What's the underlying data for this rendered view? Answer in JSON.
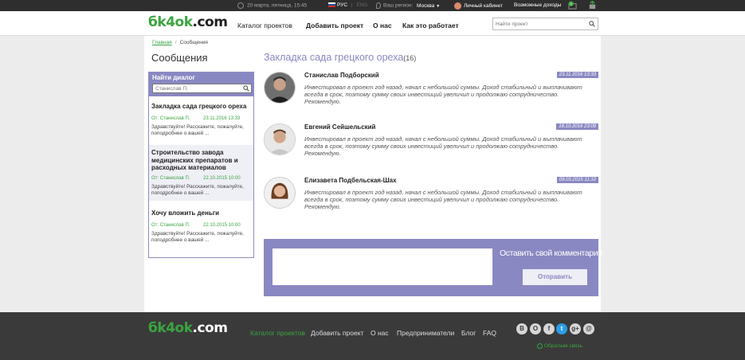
{
  "topbar": {
    "datetime": "20 марта, пятница, 15:45",
    "lang_ru": "РУС",
    "lang_divider": "|",
    "lang_en": "ENG",
    "region_label": "Ваш регион:",
    "region_value": "Москва",
    "cabinet": "Личный кабинет",
    "income": "Возможные доходы",
    "notif_count": "0"
  },
  "header": {
    "logo_a": "бk",
    "logo_b": "4ok",
    "logo_c": ".com",
    "nav": [
      "Каталог проектов",
      "Добавить проект",
      "О нас",
      "Как это работает"
    ],
    "search_placeholder": "Найти проект"
  },
  "breadcrumb": {
    "home": "Главная",
    "sep": "/",
    "current": "Сообщения"
  },
  "sidebar": {
    "title": "Сообщения",
    "find_label": "Найти диалог",
    "search_placeholder": "Станислав П.",
    "dialogs": [
      {
        "title": "Закладка сада грецкого ореха",
        "from": "От: Станислав П.",
        "date": "23.11.2016 13:33",
        "snippet": "Здравствуйте! Расскажите, пожалуйте, поподробнее о вашей ..."
      },
      {
        "title": "Строительство завода медицинских препаратов и расходных материалов",
        "from": "От: Станислав П.",
        "date": "22.10.2015 10:00",
        "snippet": "Здравствуйте! Расскажите, пожалуйте, поподробнее о вашей ..."
      },
      {
        "title": "Хочу вложить деньги",
        "from": "От: Станислав П.",
        "date": "22.10.2015 10:00",
        "snippet": "Здравствуйте! Расскажите, пожалуйте, поподробнее о вашей ..."
      }
    ]
  },
  "thread": {
    "title": "Закладка сада грецкого ореха",
    "count": "(16)",
    "comments": [
      {
        "name": "Станислав Подборский",
        "date": "23.11.2016 13:33",
        "text": "Инвестировал в проект год назад, начал с небольшой суммы. Доход стабильный и выплачивают всегда в срок, поэтому сумму своих инвестиций увеличил и продолжаю сотрудничество. Рекомендую."
      },
      {
        "name": "Евгений Сейшельский",
        "date": "18.10.2016 23:09",
        "text": "Инвестировал в проект год назад, начал с небольшой суммы. Доход стабильный и выплачивают всегда в срок, поэтому сумму своих инвестиций увеличил и продолжаю сотрудничество. Рекомендую."
      },
      {
        "name": "Елизавета Подбельская-Шах",
        "date": "09.03.2015 11:10",
        "text": "Инвестировал в проект год назад, начал с небольшой суммы. Доход стабильный и выплачивают всегда в срок, поэтому сумму своих инвестиций увеличил и продолжаю сотрудничество. Рекомендую."
      }
    ],
    "reply_label": "Оставить свой комментарий:",
    "send_button": "Отправить"
  },
  "footer": {
    "nav": [
      "Каталог проектов",
      "Добавить проект",
      "О нас",
      "Предприниматели",
      "Блог",
      "FAQ"
    ],
    "social": [
      "В",
      "О",
      "f",
      "t",
      "g+",
      "@"
    ],
    "feedback": "Обратная связь"
  },
  "colors": {
    "accent": "#8a88c2",
    "green": "#3aa540",
    "dark": "#2e2e2e",
    "footer": "#3a3a3a"
  }
}
